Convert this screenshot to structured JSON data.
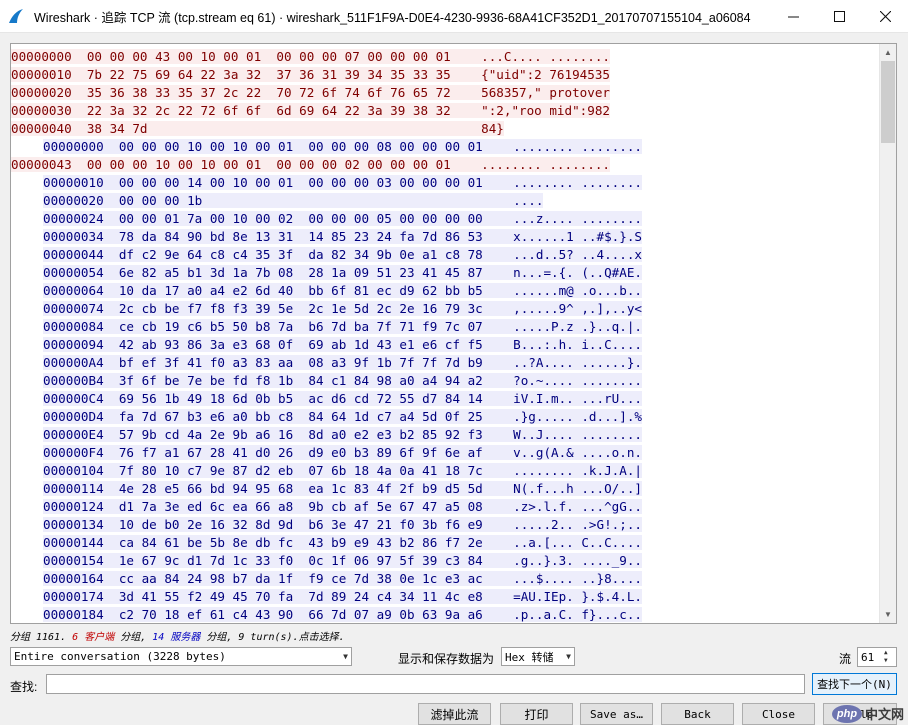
{
  "window": {
    "title": "Wireshark · 追踪 TCP 流 (tcp.stream eq 61) · wireshark_511F1F9A-D0E4-4230-9936-68A41CF352D1_20170707155104_a06084"
  },
  "colors": {
    "client_fg": "#7f0000",
    "client_bg": "#fbeded",
    "server_fg": "#00007f",
    "server_bg": "#ededfb"
  },
  "stream": {
    "lines": [
      {
        "dir": "client",
        "off": "00000000",
        "hex": "00 00 00 43 00 10 00 01  00 00 00 07 00 00 00 01",
        "ascii": "...C.... ........"
      },
      {
        "dir": "client",
        "off": "00000010",
        "hex": "7b 22 75 69 64 22 3a 32  37 36 31 39 34 35 33 35",
        "ascii": "{\"uid\":2 76194535"
      },
      {
        "dir": "client",
        "off": "00000020",
        "hex": "35 36 38 33 35 37 2c 22  70 72 6f 74 6f 76 65 72",
        "ascii": "568357,\" protover"
      },
      {
        "dir": "client",
        "off": "00000030",
        "hex": "22 3a 32 2c 22 72 6f 6f  6d 69 64 22 3a 39 38 32",
        "ascii": "\":2,\"roo mid\":982"
      },
      {
        "dir": "client",
        "off": "00000040",
        "hex": "38 34 7d",
        "ascii": "84}"
      },
      {
        "dir": "server",
        "off": "00000000",
        "hex": "00 00 00 10 00 10 00 01  00 00 00 08 00 00 00 01",
        "ascii": "........ ........"
      },
      {
        "dir": "client",
        "off": "00000043",
        "hex": "00 00 00 10 00 10 00 01  00 00 00 02 00 00 00 01",
        "ascii": "........ ........"
      },
      {
        "dir": "server",
        "off": "00000010",
        "hex": "00 00 00 14 00 10 00 01  00 00 00 03 00 00 00 01",
        "ascii": "........ ........"
      },
      {
        "dir": "server",
        "off": "00000020",
        "hex": "00 00 00 1b",
        "ascii": "...."
      },
      {
        "dir": "server",
        "off": "00000024",
        "hex": "00 00 01 7a 00 10 00 02  00 00 00 05 00 00 00 00",
        "ascii": "...z.... ........"
      },
      {
        "dir": "server",
        "off": "00000034",
        "hex": "78 da 84 90 bd 8e 13 31  14 85 23 24 fa 7d 86 53",
        "ascii": "x......1 ..#$.}.S"
      },
      {
        "dir": "server",
        "off": "00000044",
        "hex": "df c2 9e 64 c8 c4 35 3f  da 82 34 9b 0e a1 c8 78",
        "ascii": "...d..5? ..4....x"
      },
      {
        "dir": "server",
        "off": "00000054",
        "hex": "6e 82 a5 b1 3d 1a 7b 08  28 1a 09 51 23 41 45 87",
        "ascii": "n...=.{. (..Q#AE."
      },
      {
        "dir": "server",
        "off": "00000064",
        "hex": "10 da 17 a0 a4 e2 6d 40  bb 6f 81 ec d9 62 bb b5",
        "ascii": "......m@ .o...b.."
      },
      {
        "dir": "server",
        "off": "00000074",
        "hex": "2c cb be f7 f8 f3 39 5e  2c 1e 5d 2c 2e 16 79 3c",
        "ascii": ",.....9^ ,.],..y<"
      },
      {
        "dir": "server",
        "off": "00000084",
        "hex": "ce cb 19 c6 b5 50 b8 7a  b6 7d ba 7f 71 f9 7c 07",
        "ascii": ".....P.z .}..q.|."
      },
      {
        "dir": "server",
        "off": "00000094",
        "hex": "42 ab 93 86 3a e3 68 0f  69 ab 1d 43 e1 e6 cf f5",
        "ascii": "B...:.h. i..C...."
      },
      {
        "dir": "server",
        "off": "000000A4",
        "hex": "bf ef 3f 41 f0 a3 83 aa  08 a3 9f 1b 7f 7f 7d b9",
        "ascii": "..?A.... ......}."
      },
      {
        "dir": "server",
        "off": "000000B4",
        "hex": "3f 6f be 7e be fd f8 1b  84 c1 84 98 a0 a4 94 a2",
        "ascii": "?o.~.... ........"
      },
      {
        "dir": "server",
        "off": "000000C4",
        "hex": "69 56 1b 49 18 6d 0b b5  ac d6 cd 72 55 d7 84 14",
        "ascii": "iV.I.m.. ...rU..."
      },
      {
        "dir": "server",
        "off": "000000D4",
        "hex": "fa 7d 67 b3 e6 a0 bb c8  84 64 1d c7 a4 5d 0f 25",
        "ascii": ".}g..... .d...].%"
      },
      {
        "dir": "server",
        "off": "000000E4",
        "hex": "57 9b cd 4a 2e 9b a6 16  8d a0 e2 e3 b2 85 92 f3",
        "ascii": "W..J.... ........"
      },
      {
        "dir": "server",
        "off": "000000F4",
        "hex": "76 f7 a1 67 28 41 d0 26  d9 e0 b3 89 6f 9f 6e af",
        "ascii": "v..g(A.& ....o.n."
      },
      {
        "dir": "server",
        "off": "00000104",
        "hex": "7f 80 10 c7 9e 87 d2 eb  07 6b 18 4a 0a 41 18 7c",
        "ascii": "........ .k.J.A.|"
      },
      {
        "dir": "server",
        "off": "00000114",
        "hex": "4e 28 e5 66 bd 94 95 68  ea 1c 83 4f 2f b9 d5 5d",
        "ascii": "N(.f...h ...O/..]"
      },
      {
        "dir": "server",
        "off": "00000124",
        "hex": "d1 7a 3e ed 6c ea 66 a8  9b cb af 5e 67 47 a5 08",
        "ascii": ".z>.l.f. ...^gG.."
      },
      {
        "dir": "server",
        "off": "00000134",
        "hex": "10 de b0 2e 16 32 8d 9d  b6 3e 47 21 f0 3b f6 e9",
        "ascii": ".....2.. .>G!.;.."
      },
      {
        "dir": "server",
        "off": "00000144",
        "hex": "ca 84 61 be 5b 8e db fc  43 b9 e9 43 b2 86 f7 2e",
        "ascii": "..a.[... C..C...."
      },
      {
        "dir": "server",
        "off": "00000154",
        "hex": "1e 67 9c d1 7d 1c 33 f0  0c 1f 06 97 5f 39 c3 84",
        "ascii": ".g..}.3. ...._9.."
      },
      {
        "dir": "server",
        "off": "00000164",
        "hex": "cc aa 84 24 98 b7 da 1f  f9 ce 7d 38 0e 1c e3 ac",
        "ascii": "...$.... ..}8...."
      },
      {
        "dir": "server",
        "off": "00000174",
        "hex": "3d 41 55 f2 49 45 70 fa  7d 89 24 c4 34 11 4c e8",
        "ascii": "=AU.IEp. }.$.4.L."
      },
      {
        "dir": "server",
        "off": "00000184",
        "hex": "c2 70 18 ef 61 c4 43 90  66 7d 07 a9 0b 63 9a a6",
        "ascii": ".p..a.C. f}...c.."
      }
    ]
  },
  "status": {
    "prefix": "分组 1161. ",
    "client_count": "6 客户端",
    "mid": " 分组, ",
    "server_count": "14 服务器",
    "suffix": " 分组, 9 turn(s).点击选择."
  },
  "controls": {
    "conversation_select": "Entire conversation (3228 bytes)",
    "show_save_label": "显示和保存数据为",
    "format_select": "Hex 转储",
    "stream_label": "流",
    "stream_value": "61",
    "find_label": "查找:",
    "find_next": "查找下一个(N)",
    "filter_out": "滤掉此流",
    "print": "打印",
    "save_as": "Save as…",
    "back": "Back",
    "close": "Close",
    "help": "Help"
  },
  "watermark": {
    "logo": "php",
    "text": "中文网"
  }
}
